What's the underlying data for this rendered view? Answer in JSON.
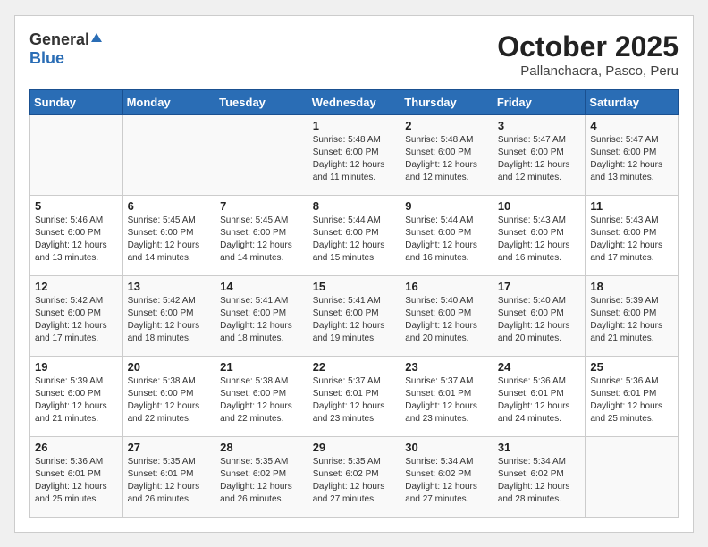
{
  "header": {
    "logo_general": "General",
    "logo_blue": "Blue",
    "month": "October 2025",
    "location": "Pallanchacra, Pasco, Peru"
  },
  "days_of_week": [
    "Sunday",
    "Monday",
    "Tuesday",
    "Wednesday",
    "Thursday",
    "Friday",
    "Saturday"
  ],
  "weeks": [
    [
      {
        "day": "",
        "info": ""
      },
      {
        "day": "",
        "info": ""
      },
      {
        "day": "",
        "info": ""
      },
      {
        "day": "1",
        "info": "Sunrise: 5:48 AM\nSunset: 6:00 PM\nDaylight: 12 hours and 11 minutes."
      },
      {
        "day": "2",
        "info": "Sunrise: 5:48 AM\nSunset: 6:00 PM\nDaylight: 12 hours and 12 minutes."
      },
      {
        "day": "3",
        "info": "Sunrise: 5:47 AM\nSunset: 6:00 PM\nDaylight: 12 hours and 12 minutes."
      },
      {
        "day": "4",
        "info": "Sunrise: 5:47 AM\nSunset: 6:00 PM\nDaylight: 12 hours and 13 minutes."
      }
    ],
    [
      {
        "day": "5",
        "info": "Sunrise: 5:46 AM\nSunset: 6:00 PM\nDaylight: 12 hours and 13 minutes."
      },
      {
        "day": "6",
        "info": "Sunrise: 5:45 AM\nSunset: 6:00 PM\nDaylight: 12 hours and 14 minutes."
      },
      {
        "day": "7",
        "info": "Sunrise: 5:45 AM\nSunset: 6:00 PM\nDaylight: 12 hours and 14 minutes."
      },
      {
        "day": "8",
        "info": "Sunrise: 5:44 AM\nSunset: 6:00 PM\nDaylight: 12 hours and 15 minutes."
      },
      {
        "day": "9",
        "info": "Sunrise: 5:44 AM\nSunset: 6:00 PM\nDaylight: 12 hours and 16 minutes."
      },
      {
        "day": "10",
        "info": "Sunrise: 5:43 AM\nSunset: 6:00 PM\nDaylight: 12 hours and 16 minutes."
      },
      {
        "day": "11",
        "info": "Sunrise: 5:43 AM\nSunset: 6:00 PM\nDaylight: 12 hours and 17 minutes."
      }
    ],
    [
      {
        "day": "12",
        "info": "Sunrise: 5:42 AM\nSunset: 6:00 PM\nDaylight: 12 hours and 17 minutes."
      },
      {
        "day": "13",
        "info": "Sunrise: 5:42 AM\nSunset: 6:00 PM\nDaylight: 12 hours and 18 minutes."
      },
      {
        "day": "14",
        "info": "Sunrise: 5:41 AM\nSunset: 6:00 PM\nDaylight: 12 hours and 18 minutes."
      },
      {
        "day": "15",
        "info": "Sunrise: 5:41 AM\nSunset: 6:00 PM\nDaylight: 12 hours and 19 minutes."
      },
      {
        "day": "16",
        "info": "Sunrise: 5:40 AM\nSunset: 6:00 PM\nDaylight: 12 hours and 20 minutes."
      },
      {
        "day": "17",
        "info": "Sunrise: 5:40 AM\nSunset: 6:00 PM\nDaylight: 12 hours and 20 minutes."
      },
      {
        "day": "18",
        "info": "Sunrise: 5:39 AM\nSunset: 6:00 PM\nDaylight: 12 hours and 21 minutes."
      }
    ],
    [
      {
        "day": "19",
        "info": "Sunrise: 5:39 AM\nSunset: 6:00 PM\nDaylight: 12 hours and 21 minutes."
      },
      {
        "day": "20",
        "info": "Sunrise: 5:38 AM\nSunset: 6:00 PM\nDaylight: 12 hours and 22 minutes."
      },
      {
        "day": "21",
        "info": "Sunrise: 5:38 AM\nSunset: 6:00 PM\nDaylight: 12 hours and 22 minutes."
      },
      {
        "day": "22",
        "info": "Sunrise: 5:37 AM\nSunset: 6:01 PM\nDaylight: 12 hours and 23 minutes."
      },
      {
        "day": "23",
        "info": "Sunrise: 5:37 AM\nSunset: 6:01 PM\nDaylight: 12 hours and 23 minutes."
      },
      {
        "day": "24",
        "info": "Sunrise: 5:36 AM\nSunset: 6:01 PM\nDaylight: 12 hours and 24 minutes."
      },
      {
        "day": "25",
        "info": "Sunrise: 5:36 AM\nSunset: 6:01 PM\nDaylight: 12 hours and 25 minutes."
      }
    ],
    [
      {
        "day": "26",
        "info": "Sunrise: 5:36 AM\nSunset: 6:01 PM\nDaylight: 12 hours and 25 minutes."
      },
      {
        "day": "27",
        "info": "Sunrise: 5:35 AM\nSunset: 6:01 PM\nDaylight: 12 hours and 26 minutes."
      },
      {
        "day": "28",
        "info": "Sunrise: 5:35 AM\nSunset: 6:02 PM\nDaylight: 12 hours and 26 minutes."
      },
      {
        "day": "29",
        "info": "Sunrise: 5:35 AM\nSunset: 6:02 PM\nDaylight: 12 hours and 27 minutes."
      },
      {
        "day": "30",
        "info": "Sunrise: 5:34 AM\nSunset: 6:02 PM\nDaylight: 12 hours and 27 minutes."
      },
      {
        "day": "31",
        "info": "Sunrise: 5:34 AM\nSunset: 6:02 PM\nDaylight: 12 hours and 28 minutes."
      },
      {
        "day": "",
        "info": ""
      }
    ]
  ]
}
